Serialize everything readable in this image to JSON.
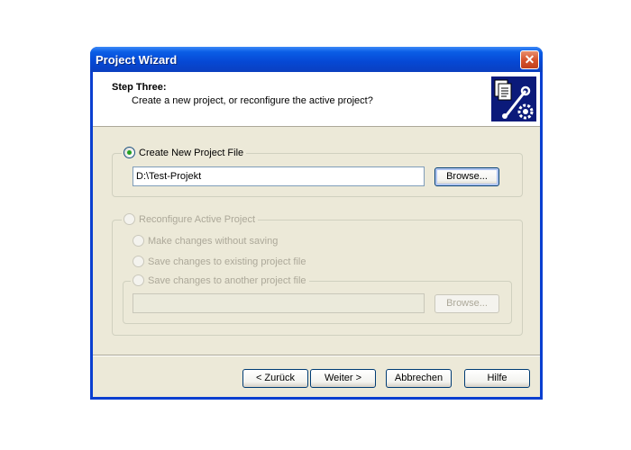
{
  "window": {
    "title": "Project Wizard",
    "close_glyph": "✕"
  },
  "header": {
    "step_title": "Step Three:",
    "step_desc": "Create a new project, or reconfigure the active project?",
    "icon": "document-wrench-gear-icon"
  },
  "create_group": {
    "label": "Create New Project File",
    "selected": true,
    "path_value": "D:\\Test-Projekt",
    "browse_label": "Browse..."
  },
  "reconfigure_group": {
    "label": "Reconfigure Active Project",
    "enabled": false,
    "options": [
      "Make changes without saving",
      "Save changes to existing project file",
      "Save changes to another project file"
    ],
    "path_value": "",
    "browse_label": "Browse..."
  },
  "footer": {
    "back_label": "< Zurück",
    "next_label": "Weiter >",
    "cancel_label": "Abbrechen",
    "help_label": "Hilfe"
  }
}
